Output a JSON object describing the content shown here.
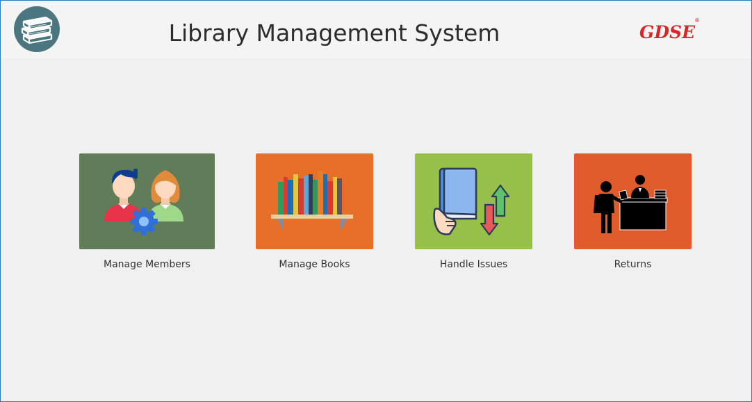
{
  "app": {
    "title": "Library Management System",
    "brand": "GDSE",
    "brand_mark": "®"
  },
  "tiles": [
    {
      "label": "Manage Members",
      "icon": "members-icon",
      "color": "#607c58"
    },
    {
      "label": "Manage Books",
      "icon": "bookshelf-icon",
      "color": "#e86f2a"
    },
    {
      "label": "Handle Issues",
      "icon": "book-issue-icon",
      "color": "#97c04a"
    },
    {
      "label": "Returns",
      "icon": "returns-desk-icon",
      "color": "#e05c2c"
    }
  ],
  "colors": {
    "background": "#f0f0f0",
    "header": "#f4f4f4",
    "logo_circle": "#4a7680",
    "brand": "#d8262a",
    "window_border": "#2b7ab8"
  }
}
